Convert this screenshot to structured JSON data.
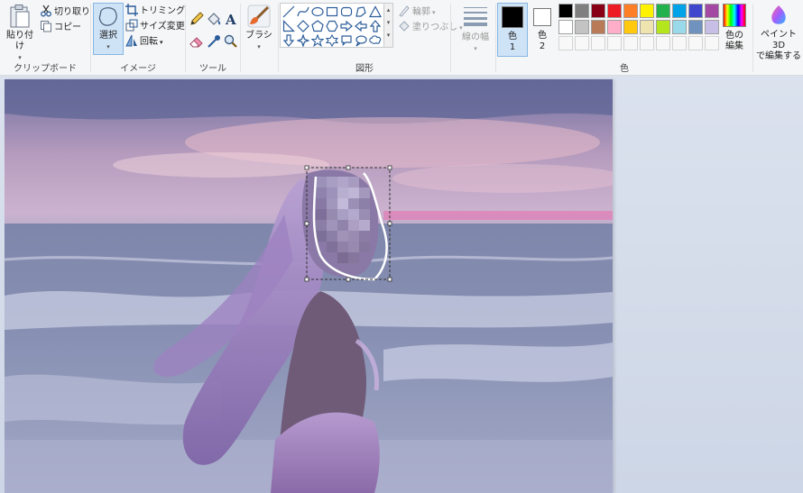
{
  "clipboard": {
    "paste_label": "貼り付け",
    "cut_label": "切り取り",
    "copy_label": "コピー",
    "group_label": "クリップボード"
  },
  "image": {
    "select_label": "選択",
    "crop_label": "トリミング",
    "resize_label": "サイズ変更",
    "rotate_label": "回転",
    "group_label": "イメージ"
  },
  "tools": {
    "group_label": "ツール"
  },
  "brushes": {
    "label": "ブラシ"
  },
  "shapes": {
    "outline_label": "輪郭",
    "fill_label": "塗りつぶし",
    "group_label": "図形"
  },
  "size": {
    "label": "線の幅"
  },
  "color1": {
    "label_line1": "色",
    "label_line2": "1",
    "value": "#000000"
  },
  "color2": {
    "label_line1": "色",
    "label_line2": "2",
    "value": "#ffffff"
  },
  "colors": {
    "group_label": "色",
    "edit_label_line1": "色の",
    "edit_label_line2": "編集",
    "palette_row1": [
      "#000000",
      "#7f7f7f",
      "#880015",
      "#ed1c24",
      "#ff7f27",
      "#fff200",
      "#22b14c",
      "#00a2e8",
      "#3f48cc",
      "#a349a4"
    ],
    "palette_row2": [
      "#ffffff",
      "#c3c3c3",
      "#b97a57",
      "#ffaec9",
      "#ffc90e",
      "#efe4b0",
      "#b5e61d",
      "#99d9ea",
      "#7092be",
      "#c8bfe7"
    ]
  },
  "paint3d": {
    "label_line1": "ペイント 3D",
    "label_line2": "で編集する"
  }
}
